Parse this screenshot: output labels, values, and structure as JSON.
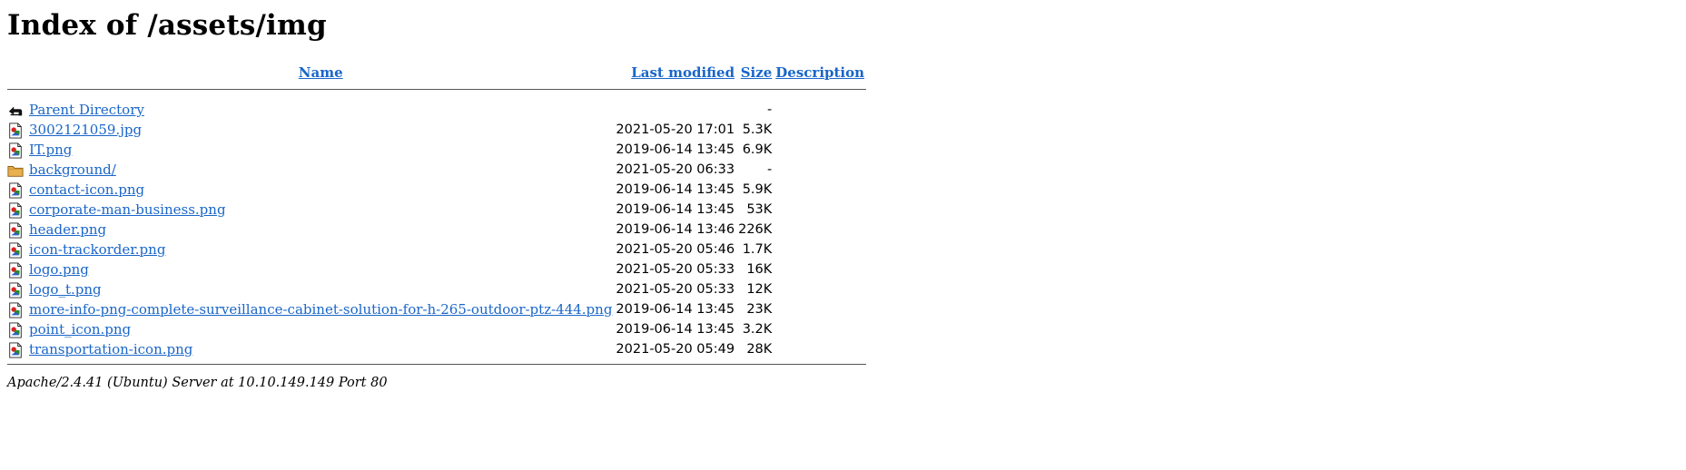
{
  "page": {
    "title": "Index of /assets/img"
  },
  "columns": {
    "name": "Name",
    "last_modified": "Last modified",
    "size": "Size",
    "description": "Description"
  },
  "entries": [
    {
      "icon": "back-arrow-icon",
      "name": "Parent Directory",
      "modified": "",
      "size": "-"
    },
    {
      "icon": "image-file-icon",
      "name": "3002121059.jpg",
      "modified": "2021-05-20 17:01",
      "size": "5.3K"
    },
    {
      "icon": "image-file-icon",
      "name": "IT.png",
      "modified": "2019-06-14 13:45",
      "size": "6.9K"
    },
    {
      "icon": "folder-icon",
      "name": "background/",
      "modified": "2021-05-20 06:33",
      "size": "-"
    },
    {
      "icon": "image-file-icon",
      "name": "contact-icon.png",
      "modified": "2019-06-14 13:45",
      "size": "5.9K"
    },
    {
      "icon": "image-file-icon",
      "name": "corporate-man-business.png",
      "modified": "2019-06-14 13:45",
      "size": "53K"
    },
    {
      "icon": "image-file-icon",
      "name": "header.png",
      "modified": "2019-06-14 13:46",
      "size": "226K"
    },
    {
      "icon": "image-file-icon",
      "name": "icon-trackorder.png",
      "modified": "2021-05-20 05:46",
      "size": "1.7K"
    },
    {
      "icon": "image-file-icon",
      "name": "logo.png",
      "modified": "2021-05-20 05:33",
      "size": "16K"
    },
    {
      "icon": "image-file-icon",
      "name": "logo_t.png",
      "modified": "2021-05-20 05:33",
      "size": "12K"
    },
    {
      "icon": "image-file-icon",
      "name": "more-info-png-complete-surveillance-cabinet-solution-for-h-265-outdoor-ptz-444.png",
      "modified": "2019-06-14 13:45",
      "size": "23K"
    },
    {
      "icon": "image-file-icon",
      "name": "point_icon.png",
      "modified": "2019-06-14 13:45",
      "size": "3.2K"
    },
    {
      "icon": "image-file-icon",
      "name": "transportation-icon.png",
      "modified": "2021-05-20 05:49",
      "size": "28K"
    }
  ],
  "footer": {
    "address": "Apache/2.4.41 (Ubuntu) Server at 10.10.149.149 Port 80"
  },
  "colors": {
    "link": "#1a66c9",
    "rule": "#555555"
  }
}
